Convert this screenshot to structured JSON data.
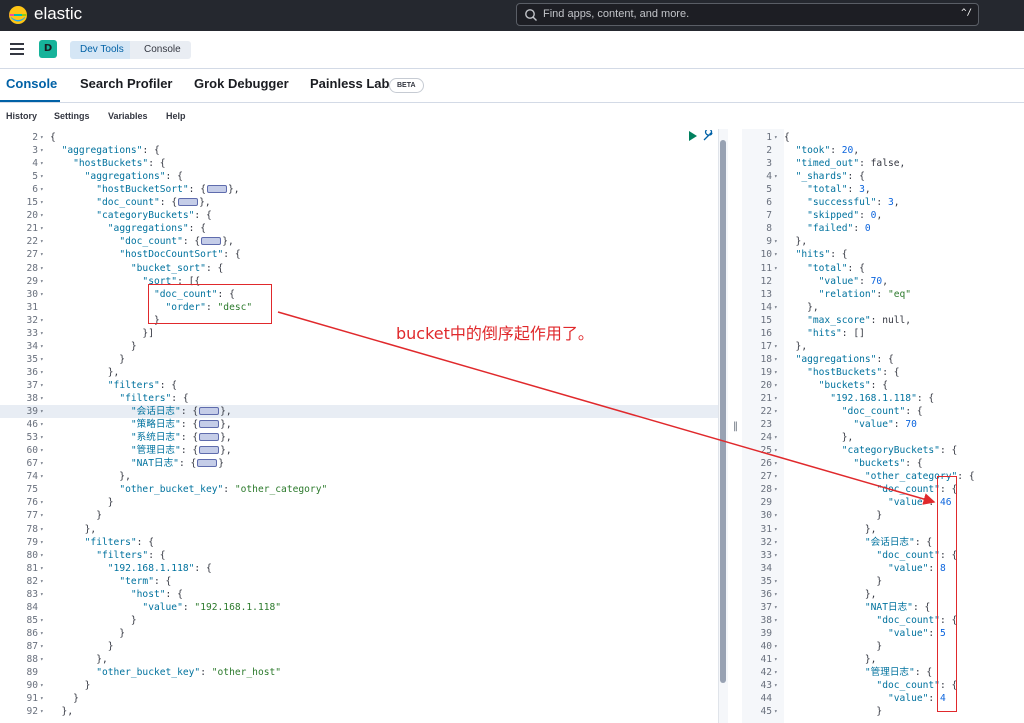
{
  "header": {
    "brand": "elastic",
    "search_placeholder": "Find apps, content, and more.",
    "search_shortcut": "^/"
  },
  "breadcrumbs": {
    "space_initial": "D",
    "items": [
      "Dev Tools",
      "Console"
    ]
  },
  "tabs": {
    "items": [
      "Console",
      "Search Profiler",
      "Grok Debugger",
      "Painless Lab"
    ],
    "beta_badge": "BETA",
    "active": "Console"
  },
  "submenu": [
    "History",
    "Settings",
    "Variables",
    "Help"
  ],
  "request_editor": {
    "lines": [
      {
        "n": "2",
        "f": true,
        "c": "{"
      },
      {
        "n": "3",
        "f": true,
        "c": "  \"aggregations\": {"
      },
      {
        "n": "4",
        "f": true,
        "c": "    \"hostBuckets\": {"
      },
      {
        "n": "5",
        "f": true,
        "c": "      \"aggregations\": {"
      },
      {
        "n": "6",
        "f": true,
        "c": "        \"hostBucketSort\": {§},"
      },
      {
        "n": "15",
        "f": true,
        "c": "        \"doc_count\": {§},"
      },
      {
        "n": "20",
        "f": true,
        "c": "        \"categoryBuckets\": {"
      },
      {
        "n": "21",
        "f": true,
        "c": "          \"aggregations\": {"
      },
      {
        "n": "22",
        "f": true,
        "c": "            \"doc_count\": {§},"
      },
      {
        "n": "27",
        "f": true,
        "c": "            \"hostDocCountSort\": {"
      },
      {
        "n": "28",
        "f": true,
        "c": "              \"bucket_sort\": {"
      },
      {
        "n": "29",
        "f": true,
        "c": "                \"sort\": [{"
      },
      {
        "n": "30",
        "f": true,
        "c": "                  \"doc_count\": {"
      },
      {
        "n": "31",
        "f": false,
        "c": "                    \"order\": \"desc\""
      },
      {
        "n": "32",
        "f": true,
        "c": "                  }"
      },
      {
        "n": "33",
        "f": true,
        "c": "                }]"
      },
      {
        "n": "34",
        "f": true,
        "c": "              }"
      },
      {
        "n": "35",
        "f": true,
        "c": "            }"
      },
      {
        "n": "36",
        "f": true,
        "c": "          },"
      },
      {
        "n": "37",
        "f": true,
        "c": "          \"filters\": {"
      },
      {
        "n": "38",
        "f": true,
        "c": "            \"filters\": {"
      },
      {
        "n": "39",
        "f": true,
        "c": "              \"会话日志\": {§},"
      },
      {
        "n": "46",
        "f": true,
        "c": "              \"策略日志\": {§},"
      },
      {
        "n": "53",
        "f": true,
        "c": "              \"系统日志\": {§},"
      },
      {
        "n": "60",
        "f": true,
        "c": "              \"管理日志\": {§},"
      },
      {
        "n": "67",
        "f": true,
        "c": "              \"NAT日志\": {§}"
      },
      {
        "n": "74",
        "f": true,
        "c": "            },"
      },
      {
        "n": "75",
        "f": false,
        "c": "            \"other_bucket_key\": \"other_category\""
      },
      {
        "n": "76",
        "f": true,
        "c": "          }"
      },
      {
        "n": "77",
        "f": true,
        "c": "        }"
      },
      {
        "n": "78",
        "f": true,
        "c": "      },"
      },
      {
        "n": "79",
        "f": true,
        "c": "      \"filters\": {"
      },
      {
        "n": "80",
        "f": true,
        "c": "        \"filters\": {"
      },
      {
        "n": "81",
        "f": true,
        "c": "          \"192.168.1.118\": {"
      },
      {
        "n": "82",
        "f": true,
        "c": "            \"term\": {"
      },
      {
        "n": "83",
        "f": true,
        "c": "              \"host\": {"
      },
      {
        "n": "84",
        "f": false,
        "c": "                \"value\": \"192.168.1.118\""
      },
      {
        "n": "85",
        "f": true,
        "c": "              }"
      },
      {
        "n": "86",
        "f": true,
        "c": "            }"
      },
      {
        "n": "87",
        "f": true,
        "c": "          }"
      },
      {
        "n": "88",
        "f": true,
        "c": "        },"
      },
      {
        "n": "89",
        "f": false,
        "c": "        \"other_bucket_key\": \"other_host\""
      },
      {
        "n": "90",
        "f": true,
        "c": "      }"
      },
      {
        "n": "91",
        "f": true,
        "c": "    }"
      },
      {
        "n": "92",
        "f": true,
        "c": "  },"
      }
    ],
    "highlighted_line": "39"
  },
  "response_editor": {
    "lines": [
      {
        "n": "1",
        "f": true,
        "c": "{"
      },
      {
        "n": "2",
        "f": false,
        "c": "  \"took\": 20,"
      },
      {
        "n": "3",
        "f": false,
        "c": "  \"timed_out\": false,"
      },
      {
        "n": "4",
        "f": true,
        "c": "  \"_shards\": {"
      },
      {
        "n": "5",
        "f": false,
        "c": "    \"total\": 3,"
      },
      {
        "n": "6",
        "f": false,
        "c": "    \"successful\": 3,"
      },
      {
        "n": "7",
        "f": false,
        "c": "    \"skipped\": 0,"
      },
      {
        "n": "8",
        "f": false,
        "c": "    \"failed\": 0"
      },
      {
        "n": "9",
        "f": true,
        "c": "  },"
      },
      {
        "n": "10",
        "f": true,
        "c": "  \"hits\": {"
      },
      {
        "n": "11",
        "f": true,
        "c": "    \"total\": {"
      },
      {
        "n": "12",
        "f": false,
        "c": "      \"value\": 70,"
      },
      {
        "n": "13",
        "f": false,
        "c": "      \"relation\": \"eq\""
      },
      {
        "n": "14",
        "f": true,
        "c": "    },"
      },
      {
        "n": "15",
        "f": false,
        "c": "    \"max_score\": null,"
      },
      {
        "n": "16",
        "f": false,
        "c": "    \"hits\": []"
      },
      {
        "n": "17",
        "f": true,
        "c": "  },"
      },
      {
        "n": "18",
        "f": true,
        "c": "  \"aggregations\": {"
      },
      {
        "n": "19",
        "f": true,
        "c": "    \"hostBuckets\": {"
      },
      {
        "n": "20",
        "f": true,
        "c": "      \"buckets\": {"
      },
      {
        "n": "21",
        "f": true,
        "c": "        \"192.168.1.118\": {"
      },
      {
        "n": "22",
        "f": true,
        "c": "          \"doc_count\": {"
      },
      {
        "n": "23",
        "f": false,
        "c": "            \"value\": 70"
      },
      {
        "n": "24",
        "f": true,
        "c": "          },"
      },
      {
        "n": "25",
        "f": true,
        "c": "          \"categoryBuckets\": {"
      },
      {
        "n": "26",
        "f": true,
        "c": "            \"buckets\": {"
      },
      {
        "n": "27",
        "f": true,
        "c": "              \"other_category\": {"
      },
      {
        "n": "28",
        "f": true,
        "c": "                \"doc_count\": {"
      },
      {
        "n": "29",
        "f": false,
        "c": "                  \"value\": 46"
      },
      {
        "n": "30",
        "f": true,
        "c": "                }"
      },
      {
        "n": "31",
        "f": true,
        "c": "              },"
      },
      {
        "n": "32",
        "f": true,
        "c": "              \"会话日志\": {"
      },
      {
        "n": "33",
        "f": true,
        "c": "                \"doc_count\": {"
      },
      {
        "n": "34",
        "f": false,
        "c": "                  \"value\": 8"
      },
      {
        "n": "35",
        "f": true,
        "c": "                }"
      },
      {
        "n": "36",
        "f": true,
        "c": "              },"
      },
      {
        "n": "37",
        "f": true,
        "c": "              \"NAT日志\": {"
      },
      {
        "n": "38",
        "f": true,
        "c": "                \"doc_count\": {"
      },
      {
        "n": "39",
        "f": false,
        "c": "                  \"value\": 5"
      },
      {
        "n": "40",
        "f": true,
        "c": "                }"
      },
      {
        "n": "41",
        "f": true,
        "c": "              },"
      },
      {
        "n": "42",
        "f": true,
        "c": "              \"管理日志\": {"
      },
      {
        "n": "43",
        "f": true,
        "c": "                \"doc_count\": {"
      },
      {
        "n": "44",
        "f": false,
        "c": "                  \"value\": 4"
      },
      {
        "n": "45",
        "f": true,
        "c": "                }"
      }
    ]
  },
  "annotation": {
    "text": "bucket中的倒序起作用了。",
    "color": "#e0292c"
  },
  "colors": {
    "accent": "#0061a6",
    "header_bg": "#25282f",
    "string": "#2c7a2c",
    "number": "#0b64dd",
    "key": "#00729e"
  }
}
